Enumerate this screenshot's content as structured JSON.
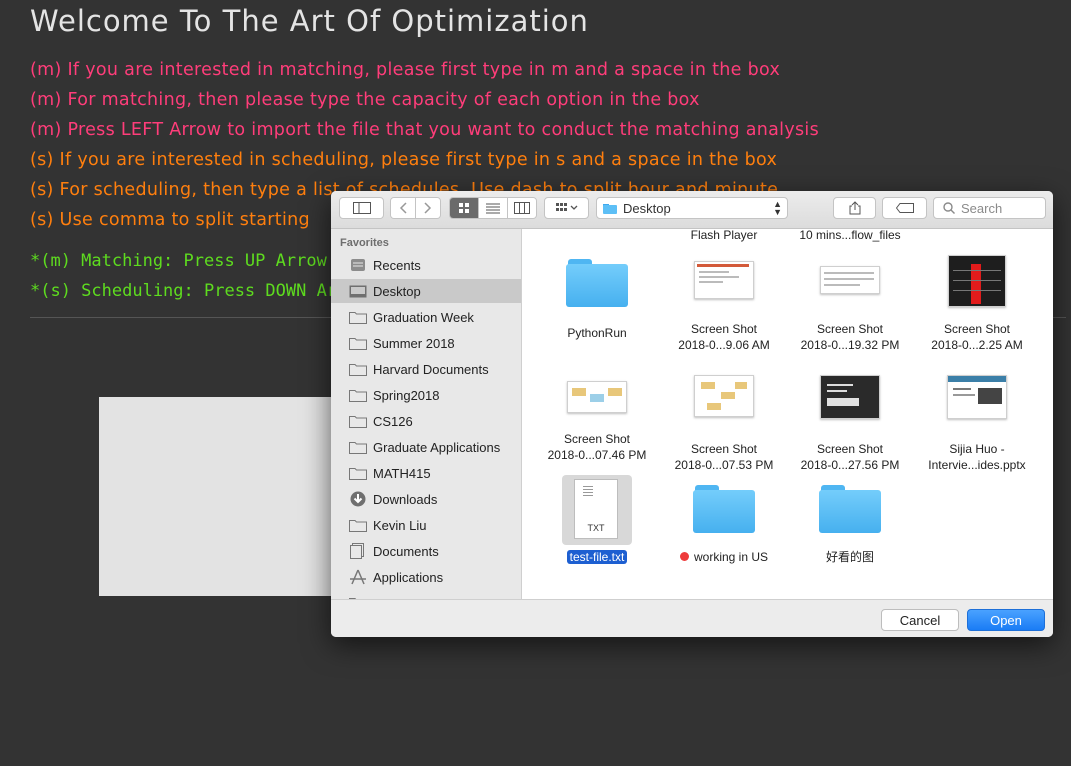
{
  "app": {
    "title": "Welcome To The Art Of Optimization",
    "instructions": [
      {
        "text": "(m) If you are interested in matching, please first type in m and a space in the box",
        "color": "#ff3d7a"
      },
      {
        "text": "(m) For matching, then please type the capacity of each option in the box",
        "color": "#ff3d7a"
      },
      {
        "text": "(m) Press LEFT Arrow to import the file that you want to conduct the matching analysis",
        "color": "#ff3d7a"
      },
      {
        "text": "(s) If you are interested in scheduling, please first type in s and a space in the box",
        "color": "#ff7f0e"
      },
      {
        "text": "(s) For scheduling, then type a list of schedules. Use dash to split hour and minute",
        "color": "#ff7f0e"
      },
      {
        "text": "(s) Use comma to split starting",
        "color": "#ff7f0e"
      }
    ],
    "hotkeys": [
      "*(m) Matching: Press UP Arrow",
      "*(s) Scheduling: Press DOWN Ar"
    ]
  },
  "dialog": {
    "location": "Desktop",
    "search_placeholder": "Search",
    "sidebar_heading": "Favorites",
    "sidebar_items": [
      {
        "label": "Recents",
        "icon": "recents-icon"
      },
      {
        "label": "Desktop",
        "icon": "desktop-icon",
        "selected": true
      },
      {
        "label": "Graduation Week",
        "icon": "folder-icon"
      },
      {
        "label": "Summer 2018",
        "icon": "folder-icon"
      },
      {
        "label": "Harvard Documents",
        "icon": "folder-icon"
      },
      {
        "label": "Spring2018",
        "icon": "folder-icon"
      },
      {
        "label": "CS126",
        "icon": "folder-icon"
      },
      {
        "label": "Graduate Applications",
        "icon": "folder-icon"
      },
      {
        "label": "MATH415",
        "icon": "folder-icon"
      },
      {
        "label": "Downloads",
        "icon": "downloads-icon"
      },
      {
        "label": "Kevin Liu",
        "icon": "folder-icon"
      },
      {
        "label": "Documents",
        "icon": "documents-icon"
      },
      {
        "label": "Applications",
        "icon": "applications-icon"
      }
    ],
    "files": [
      {
        "label1": "Flash Player",
        "label2": ""
      },
      {
        "label1": "10 mins...flow_files",
        "label2": ""
      },
      {
        "label1": "PythonRun",
        "label2": ""
      },
      {
        "label1": "Screen Shot",
        "label2": "2018-0...9.06 AM"
      },
      {
        "label1": "Screen Shot",
        "label2": "2018-0...19.32 PM"
      },
      {
        "label1": "Screen Shot",
        "label2": "2018-0...2.25 AM"
      },
      {
        "label1": "Screen Shot",
        "label2": "2018-0...07.46 PM"
      },
      {
        "label1": "Screen Shot",
        "label2": "2018-0...07.53 PM"
      },
      {
        "label1": "Screen Shot",
        "label2": "2018-0...27.56 PM"
      },
      {
        "label1": "Sijia Huo -",
        "label2": "Intervie...ides.pptx"
      },
      {
        "label1": "test-file.txt",
        "label2": "",
        "badge": "TXT"
      },
      {
        "label1": "working in US",
        "label2": ""
      },
      {
        "label1": "好看的图",
        "label2": ""
      }
    ],
    "cancel_label": "Cancel",
    "open_label": "Open"
  }
}
